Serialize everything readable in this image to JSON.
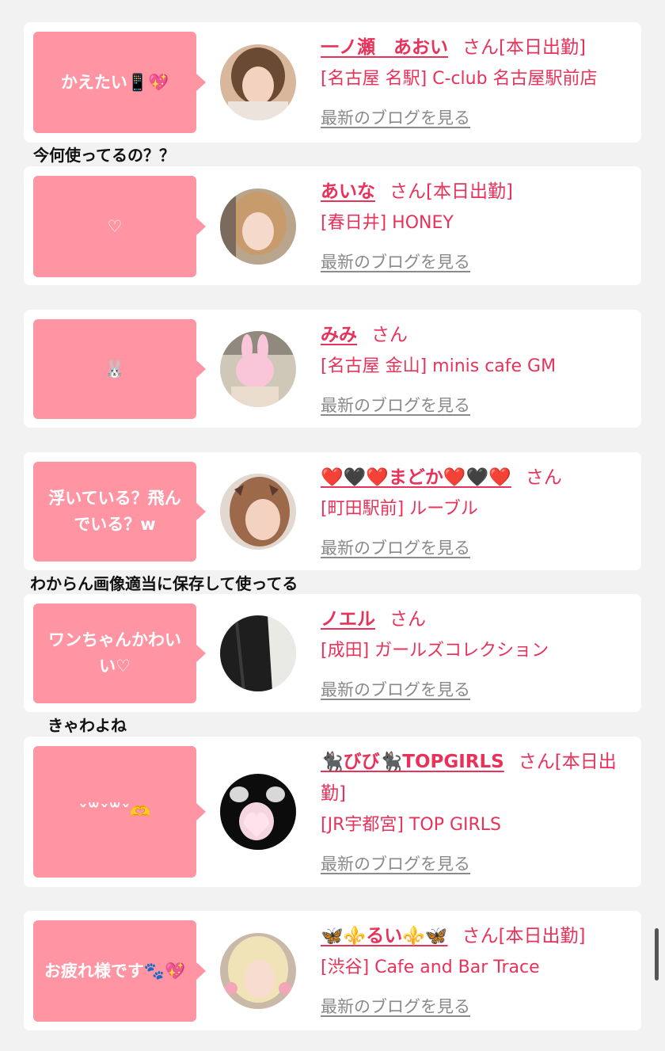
{
  "colors": {
    "accent": "#e8325a",
    "bubble": "#ff95a3",
    "link_gray": "#8a8a8a",
    "background": "#f2f2f2"
  },
  "captions": [
    "今何使ってるの？？",
    "わからん画像適当に保存して使ってる",
    "きゃわよね"
  ],
  "cards": [
    {
      "message": "かえたい📱💖",
      "name": "一ノ瀬　あおい",
      "honorific": "さん",
      "status": "[本日出勤]",
      "shop": "[名古屋 名駅] C-club 名古屋駅前店",
      "blog_link": "最新のブログを見る"
    },
    {
      "message": "♡",
      "name": "あいな",
      "honorific": "さん",
      "status": "[本日出勤]",
      "shop": "[春日井] HONEY",
      "blog_link": "最新のブログを見る"
    },
    {
      "message": "🐰",
      "name": "みみ",
      "honorific": "さん",
      "status": "",
      "shop": "[名古屋 金山] minis cafe GM",
      "blog_link": "最新のブログを見る"
    },
    {
      "message": "浮いている？飛んでいる？w",
      "name": "❤️🖤❤️まどか❤️🖤❤️",
      "honorific": "さん",
      "status": "",
      "shop": "[町田駅前] ルーブル",
      "blog_link": "最新のブログを見る"
    },
    {
      "message": "ワンちゃんかわいい♡",
      "name": "ノエル",
      "honorific": "さん",
      "status": "",
      "shop": "[成田] ガールズコレクション",
      "blog_link": "最新のブログを見る"
    },
    {
      "message": "ˇ꒳ˇ꒳ˇ🫶",
      "name": "🐈‍⬛びび🐈‍⬛TOPGIRLS",
      "honorific": "さん",
      "status": "[本日出勤]",
      "shop": "[JR宇都宮] TOP GIRLS",
      "blog_link": "最新のブログを見る"
    },
    {
      "message": "お疲れ様です🐾💖",
      "name": "🦋⚜️るい⚜️🦋",
      "honorific": "さん",
      "status": "[本日出勤]",
      "shop": "[渋谷] Cafe and Bar Trace",
      "blog_link": "最新のブログを見る"
    }
  ]
}
